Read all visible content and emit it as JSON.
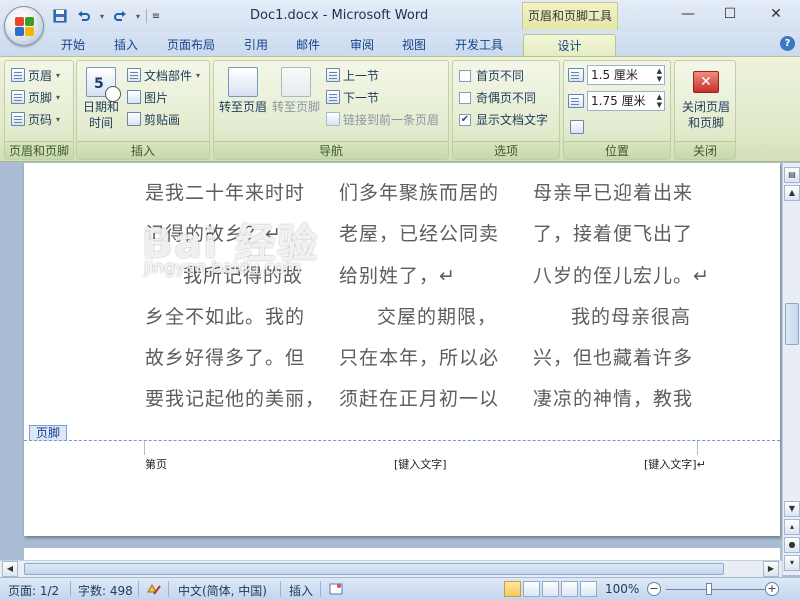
{
  "window": {
    "title": "Doc1.docx - Microsoft Word",
    "context_tool_title": "页眉和页脚工具",
    "minimize": "—",
    "maximize": "☐",
    "close": "✕"
  },
  "quick_access": {
    "save_icon": "save-icon",
    "undo_icon": "undo-icon",
    "redo_icon": "redo-icon"
  },
  "tabs": [
    "开始",
    "插入",
    "页面布局",
    "引用",
    "邮件",
    "审阅",
    "视图",
    "开发工具",
    "设计"
  ],
  "ribbon": {
    "groups": {
      "header_footer": {
        "label": "页眉和页脚",
        "items": [
          "页眉",
          "页脚",
          "页码"
        ]
      },
      "insert": {
        "label": "插入",
        "date_time": [
          "日期和",
          "时间"
        ],
        "items": [
          "文档部件",
          "图片",
          "剪贴画"
        ]
      },
      "navigation": {
        "label": "导航",
        "goto_header": "转至页眉",
        "goto_footer": "转至页脚",
        "prev": "上一节",
        "next": "下一节",
        "link": "链接到前一条页眉"
      },
      "options": {
        "label": "选项",
        "items": [
          {
            "label": "首页不同",
            "checked": false
          },
          {
            "label": "奇偶页不同",
            "checked": false
          },
          {
            "label": "显示文档文字",
            "checked": true
          }
        ]
      },
      "position": {
        "label": "位置",
        "header_pos": "1.5 厘米",
        "footer_pos": "1.75 厘米"
      },
      "close": {
        "label": "关闭",
        "button": [
          "关闭页眉",
          "和页脚"
        ]
      }
    }
  },
  "document": {
    "columns": [
      [
        "是我二十年来时时",
        "记得的故乡？↵",
        "我所记得的故",
        "乡全不如此。我的",
        "故乡好得多了。但",
        "要我记起他的美丽，"
      ],
      [
        "们多年聚族而居的",
        "老屋，已经公同卖",
        "给别姓了，↵",
        "交屋的期限，",
        "只在本年，所以必",
        "须赶在正月初一以"
      ],
      [
        "母亲早已迎着出来",
        "了，接着便飞出了",
        "八岁的侄儿宏儿。↵",
        "我的母亲很高",
        "兴，但也藏着许多",
        "凄凉的神情，教我"
      ]
    ],
    "watermark": "Bai 经验",
    "watermark_sub": "jingyan.baidu.com",
    "footer_tag": "页脚",
    "footer_left": "第页",
    "footer_center": "[键入文字]",
    "footer_right": "[键入文字]↵"
  },
  "status": {
    "page": "页面: 1/2",
    "words": "字数: 498",
    "language": "中文(简体, 中国)",
    "mode": "插入",
    "zoom": "100%",
    "zoom_level_percent": 100
  }
}
